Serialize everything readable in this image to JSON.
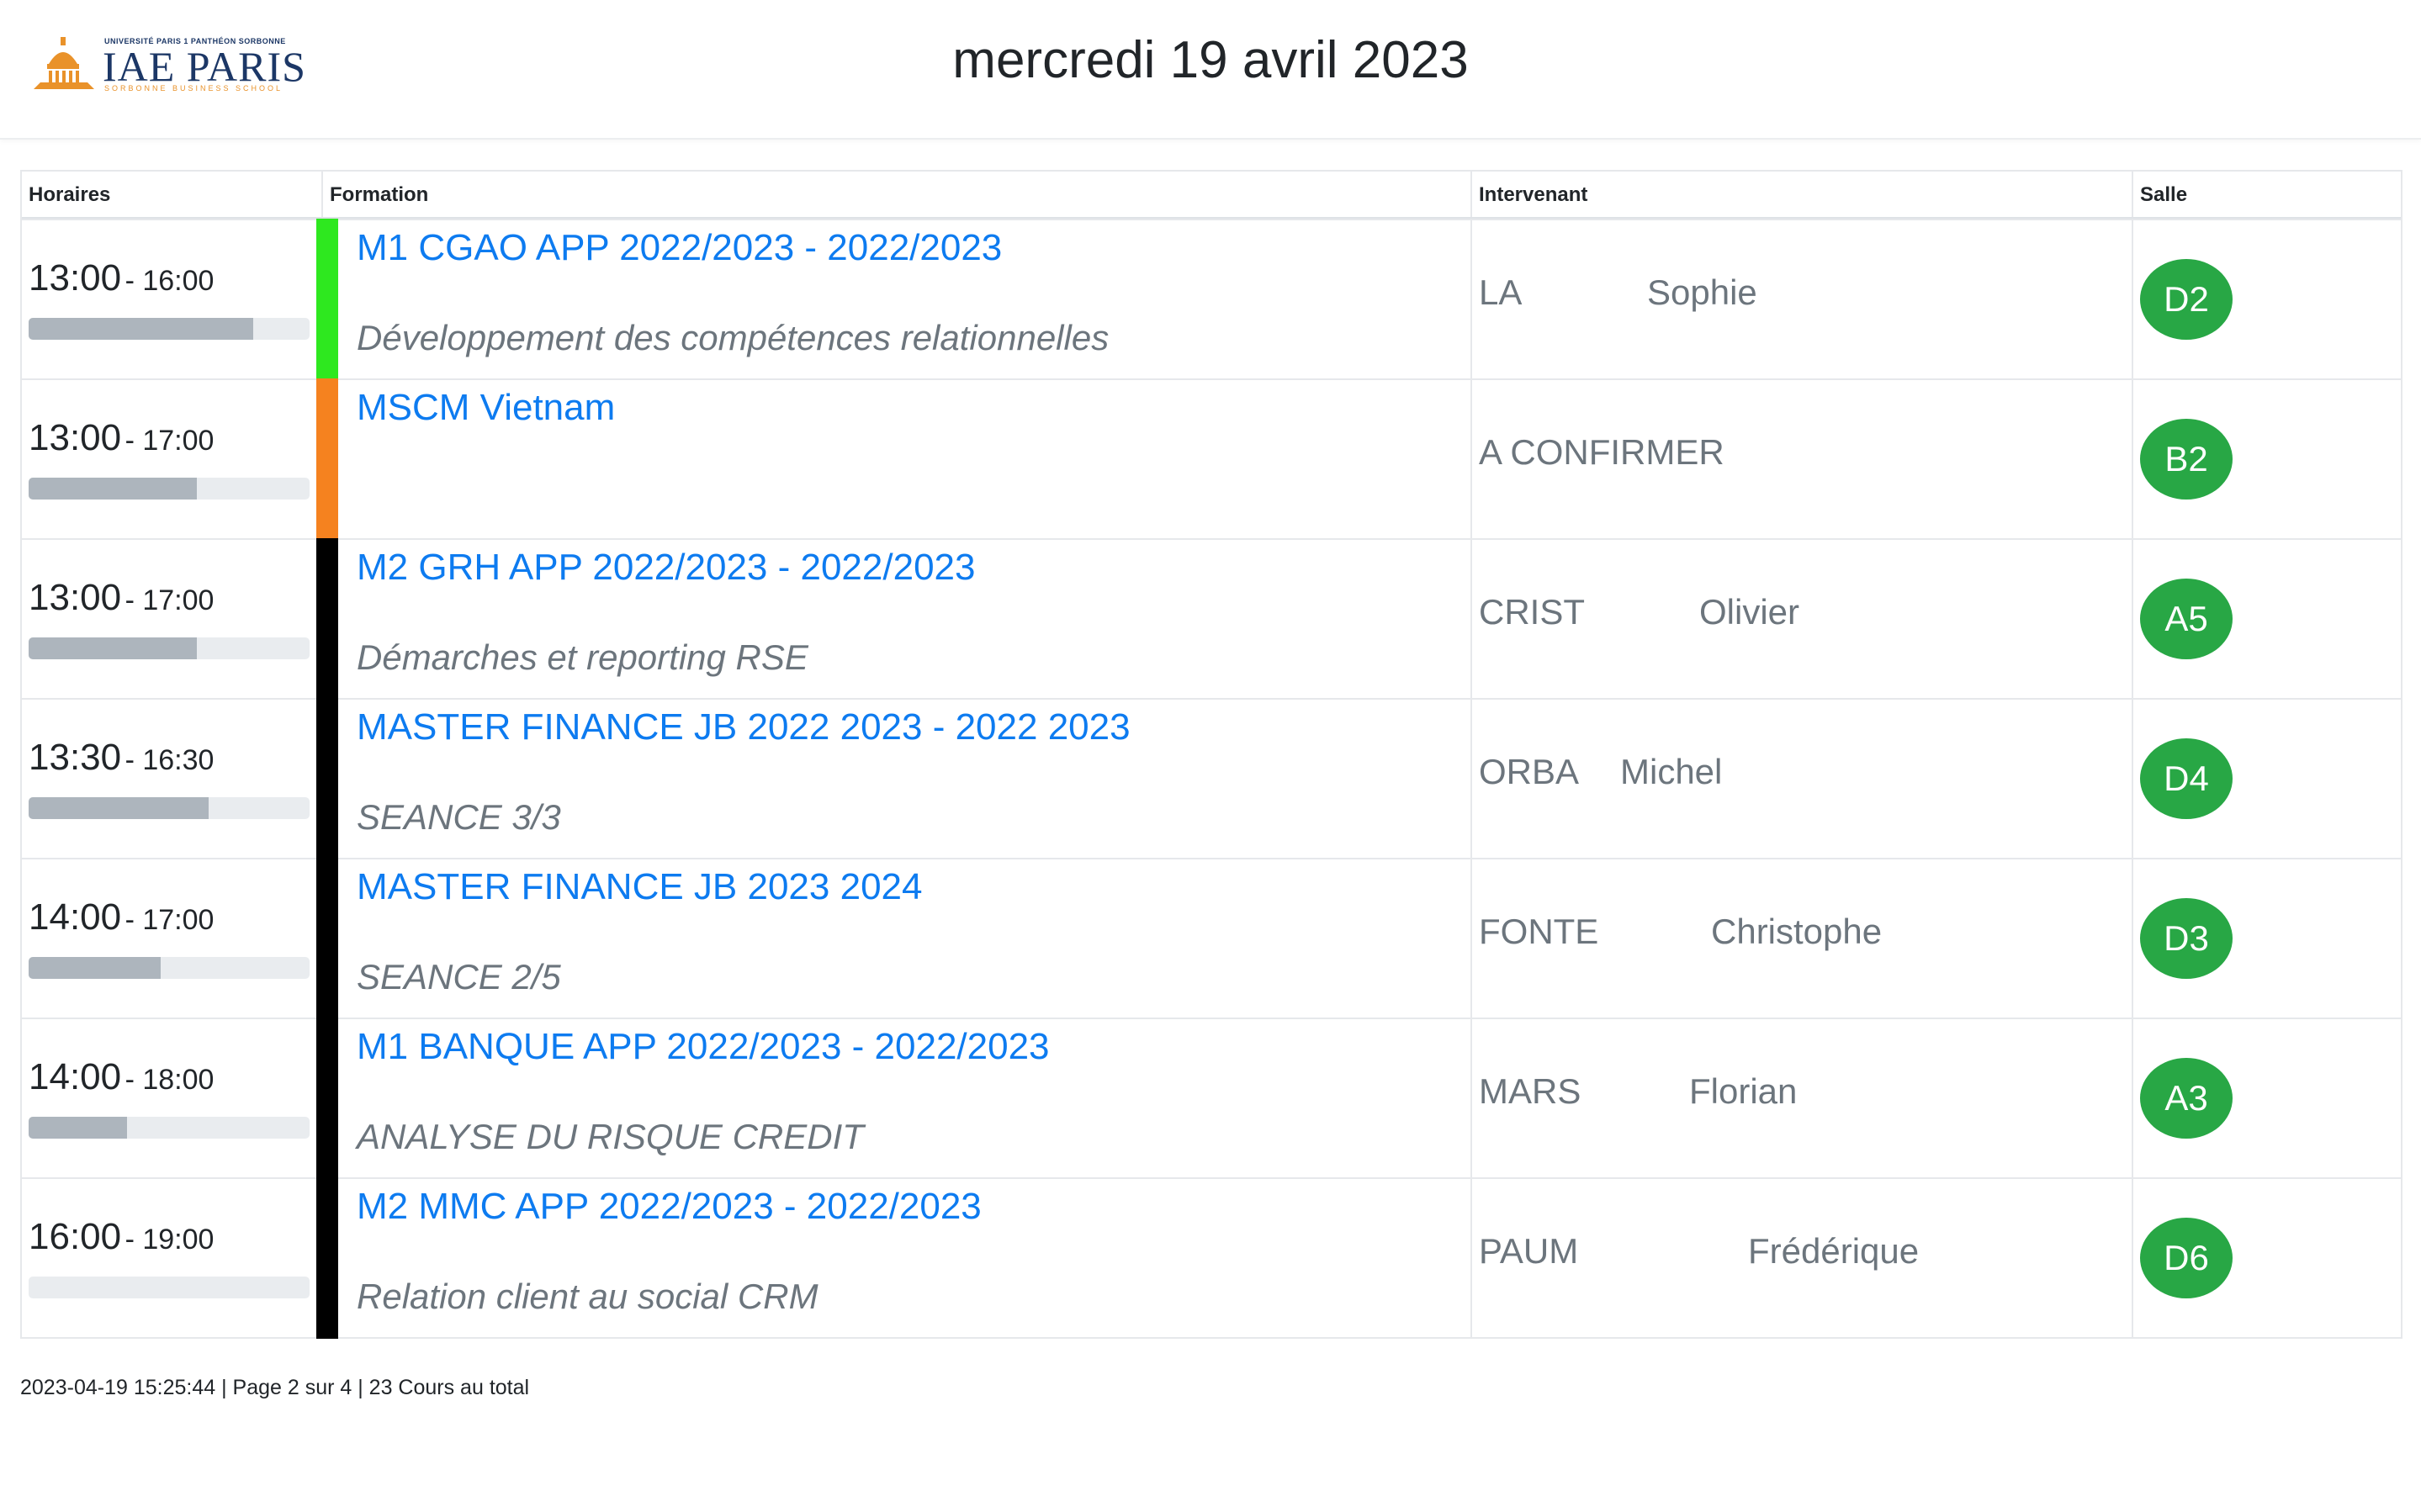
{
  "header": {
    "title": "mercredi 19 avril 2023",
    "logo": {
      "top_text": "UNIVERSITÉ PARIS 1 PANTHÉON SORBONNE",
      "main_text": "IAE PARIS",
      "sub_text": "SORBONNE BUSINESS SCHOOL"
    }
  },
  "table": {
    "columns": [
      "Horaires",
      "Formation",
      "Intervenant",
      "Salle"
    ],
    "rows": [
      {
        "start": "13:00",
        "end": "- 16:00",
        "progress": 0.8,
        "stripe": "#2ee81f",
        "course": "M1 CGAO APP 2022/2023 - 2022/2023",
        "desc": "Développement des compétences relationnelles",
        "last": "LA",
        "first": "Sophie",
        "room": "D2"
      },
      {
        "start": "13:00",
        "end": "- 17:00",
        "progress": 0.6,
        "stripe": "#f5821f",
        "course": "MSCM Vietnam",
        "desc": "",
        "last": "A CONFIRMER",
        "first": "",
        "room": "B2"
      },
      {
        "start": "13:00",
        "end": "- 17:00",
        "progress": 0.6,
        "stripe": "#000000",
        "course": "M2 GRH APP 2022/2023 - 2022/2023",
        "desc": "Démarches et reporting RSE",
        "last": "CRIST",
        "first": "Olivier",
        "room": "A5"
      },
      {
        "start": "13:30",
        "end": "- 16:30",
        "progress": 0.64,
        "stripe": "#000000",
        "course": "MASTER FINANCE JB 2022 2023 - 2022 2023",
        "desc": "SEANCE 3/3",
        "last": "ORBA",
        "first": "Michel",
        "room": "D4"
      },
      {
        "start": "14:00",
        "end": "- 17:00",
        "progress": 0.47,
        "stripe": "#000000",
        "course": "MASTER FINANCE JB 2023 2024",
        "desc": "SEANCE 2/5",
        "last": "FONTE",
        "first": "Christophe",
        "room": "D3"
      },
      {
        "start": "14:00",
        "end": "- 18:00",
        "progress": 0.35,
        "stripe": "#000000",
        "course": "M1 BANQUE APP 2022/2023 - 2022/2023",
        "desc": "ANALYSE DU RISQUE CREDIT",
        "last": "MARS",
        "first": "Florian",
        "room": "A3"
      },
      {
        "start": "16:00",
        "end": "- 19:00",
        "progress": 0.0,
        "stripe": "#000000",
        "course": "M2 MMC APP 2022/2023 - 2022/2023",
        "desc": "Relation client au social CRM",
        "last": "PAUM",
        "first": "Frédérique",
        "room": "D6"
      }
    ]
  },
  "footer": {
    "text": "2023-04-19 15:25:44 | Page 2 sur 4 | 23 Cours au total"
  },
  "colors": {
    "link": "#0d7bf0",
    "room_badge": "#28a745",
    "muted_text": "#6c757d"
  }
}
